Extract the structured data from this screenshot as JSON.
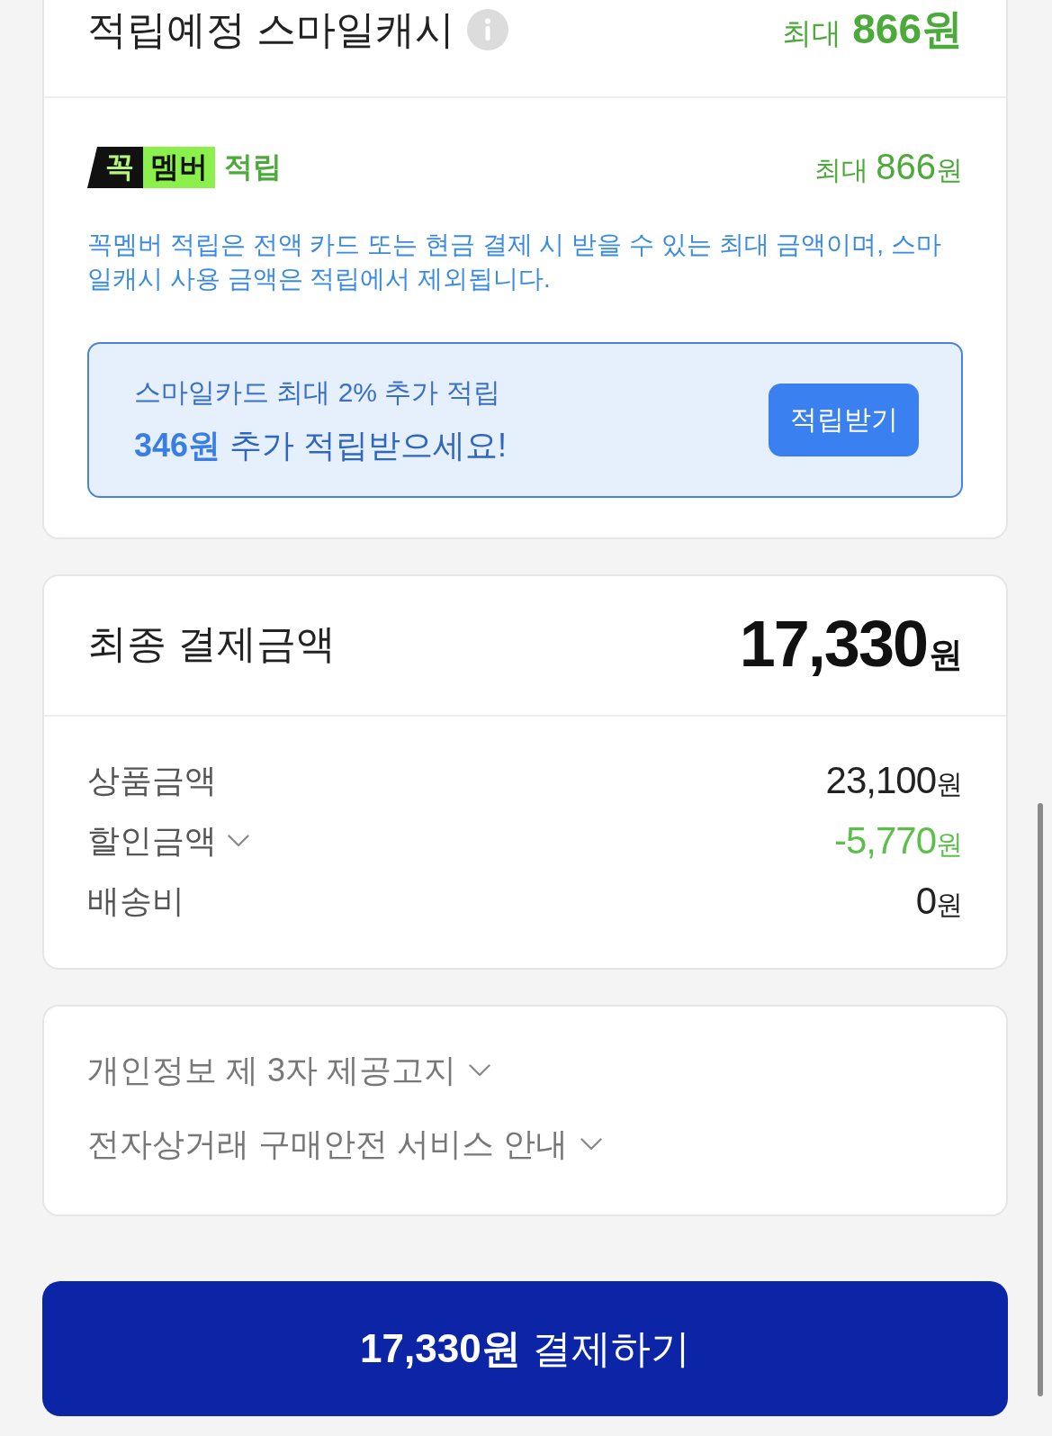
{
  "cashback_card": {
    "header": {
      "title": "적립예정 스마일캐시",
      "max_label": "최대",
      "amount": "866원"
    },
    "member_reward": {
      "badge": {
        "part_1": "꼭",
        "part_2": "멤버"
      },
      "label": "적립",
      "max_label": "최대",
      "amount": "866",
      "unit": "원"
    },
    "description": "꼭멤버 적립은 전액 카드 또는 현금 결제 시 받을 수 있는 최대 금액이며, 스마일캐시 사용 금액은 적립에서 제외됩니다.",
    "promo": {
      "line_1": "스마일카드 최대 2% 추가 적립",
      "line_2": "**346원** 추가 적립받으세요!",
      "button": "적립받기"
    }
  },
  "total_card": {
    "title": "최종 결제금액",
    "amount": "17,330",
    "unit": "원",
    "rows": [
      {
        "kind": "amount",
        "label": "상품금액",
        "value": "23,100",
        "unit": "원"
      },
      {
        "kind": "discount",
        "label": "할인금액",
        "value": "-5,770",
        "unit": "원"
      },
      {
        "kind": "amount",
        "label": "배송비",
        "value": "0",
        "unit": "원"
      }
    ]
  },
  "notices": [
    {
      "label": "개인정보 제 3자 제공고지",
      "expanded": false
    },
    {
      "label": "전자상거래 구매안전 서비스 안내",
      "expanded": false
    }
  ],
  "pay_button": {
    "label": "**17,330원** 결제하기"
  }
}
